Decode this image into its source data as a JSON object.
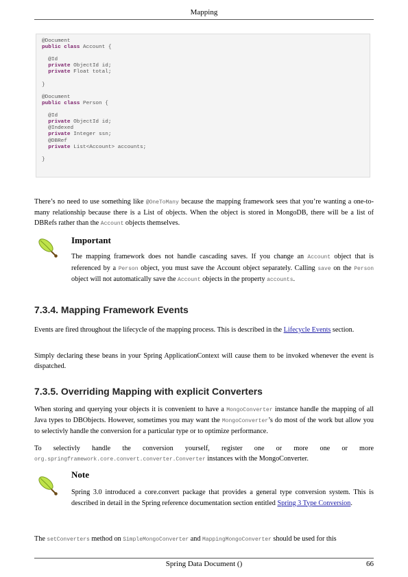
{
  "header": {
    "title": "Mapping"
  },
  "code_block": {
    "lines": [
      [
        [
          "a",
          "@Document"
        ]
      ],
      [
        [
          "k",
          "public class"
        ],
        [
          "a",
          " Account {"
        ]
      ],
      [],
      [
        [
          "a",
          "  @Id"
        ]
      ],
      [
        [
          "k",
          "  private"
        ],
        [
          "a",
          " ObjectId id;"
        ]
      ],
      [
        [
          "k",
          "  private"
        ],
        [
          "a",
          " Float total;"
        ]
      ],
      [],
      [
        [
          "a",
          "}"
        ]
      ],
      [],
      [
        [
          "a",
          "@Document"
        ]
      ],
      [
        [
          "k",
          "public class"
        ],
        [
          "a",
          " Person {"
        ]
      ],
      [],
      [
        [
          "a",
          "  @Id"
        ]
      ],
      [
        [
          "k",
          "  private"
        ],
        [
          "a",
          " ObjectId id;"
        ]
      ],
      [
        [
          "a",
          "  @Indexed"
        ]
      ],
      [
        [
          "k",
          "  private"
        ],
        [
          "a",
          " Integer ssn;"
        ]
      ],
      [
        [
          "a",
          "  @DBRef"
        ]
      ],
      [
        [
          "k",
          "  private"
        ],
        [
          "a",
          " List<Account> accounts;"
        ]
      ],
      [],
      [
        [
          "a",
          "}"
        ]
      ]
    ]
  },
  "para_dbref": [
    [
      "t",
      "There’s no need to use something like "
    ],
    [
      "m",
      "@OneToMany"
    ],
    [
      "t",
      " because the mapping framework sees that you’re wanting a one-to-many relationship because there is a List of objects. When the object is stored in MongoDB, there will be a list of DBRefs rather than the "
    ],
    [
      "m",
      "Account"
    ],
    [
      "t",
      " objects themselves."
    ]
  ],
  "important": {
    "title": "Important",
    "text": [
      [
        "t",
        "The mapping framework does not handle cascading saves. If you change an "
      ],
      [
        "m",
        "Account"
      ],
      [
        "t",
        " object that is referenced by a "
      ],
      [
        "m",
        "Person"
      ],
      [
        "t",
        " object, you must save the Account object separately. Calling "
      ],
      [
        "m",
        "save"
      ],
      [
        "t",
        " on the "
      ],
      [
        "m",
        "Person"
      ],
      [
        "t",
        " object will not automatically save the "
      ],
      [
        "m",
        "Account"
      ],
      [
        "t",
        " objects in the property "
      ],
      [
        "m",
        "accounts"
      ],
      [
        "t",
        "."
      ]
    ]
  },
  "section_events": {
    "heading": "7.3.4. Mapping Framework Events",
    "para1": [
      [
        "t",
        "Events are fired throughout the lifecycle of the mapping process. This is described in the "
      ],
      [
        "l",
        "Lifecycle Events"
      ],
      [
        "t",
        " section."
      ]
    ],
    "para2": [
      [
        "t",
        "Simply declaring these beans in your Spring ApplicationContext will cause them to be invoked whenever the event is dispatched."
      ]
    ]
  },
  "section_converters": {
    "heading": "7.3.5. Overriding Mapping with explicit Converters",
    "para1": [
      [
        "t",
        "When storing and querying your objects it is convenient to have a "
      ],
      [
        "m",
        "MongoConverter"
      ],
      [
        "t",
        " instance handle the mapping of all Java types to DBObjects. However, sometimes you may want the "
      ],
      [
        "m",
        "MongoConverter"
      ],
      [
        "t",
        "’s do most of the work but allow you to selectivly handle the conversion for a particular type or to optimize performance."
      ]
    ],
    "para2_line1": [
      [
        "t",
        "To selectivly handle the conversion yourself, register one or more one or more"
      ]
    ],
    "para2_line2": [
      [
        "m",
        "org.springframework.core.convert.converter.Converter"
      ],
      [
        "t",
        " instances with the MongoConverter."
      ]
    ]
  },
  "note": {
    "title": "Note",
    "text": [
      [
        "t",
        "Spring 3.0 introduced a core.convert package that provides a general type conversion system. This is described in detail in the Spring reference documentation section entitled "
      ],
      [
        "l",
        "Spring 3 Type Conversion"
      ],
      [
        "t",
        "."
      ]
    ]
  },
  "para_setconverters": [
    [
      "t",
      "The "
    ],
    [
      "m",
      "setConverters"
    ],
    [
      "t",
      " method on "
    ],
    [
      "m",
      "SimpleMongoConverter"
    ],
    [
      "t",
      " and "
    ],
    [
      "m",
      "MappingMongoConverter"
    ],
    [
      "t",
      " should be used for this"
    ]
  ],
  "footer": {
    "doc_title": "Spring Data Document ()",
    "page_number": "66"
  },
  "colors": {
    "keyword": "#7b1f6a",
    "link": "#1a1aa6",
    "code_background": "#f4f4f4"
  },
  "icons": {
    "admonition": "leaf-icon"
  }
}
